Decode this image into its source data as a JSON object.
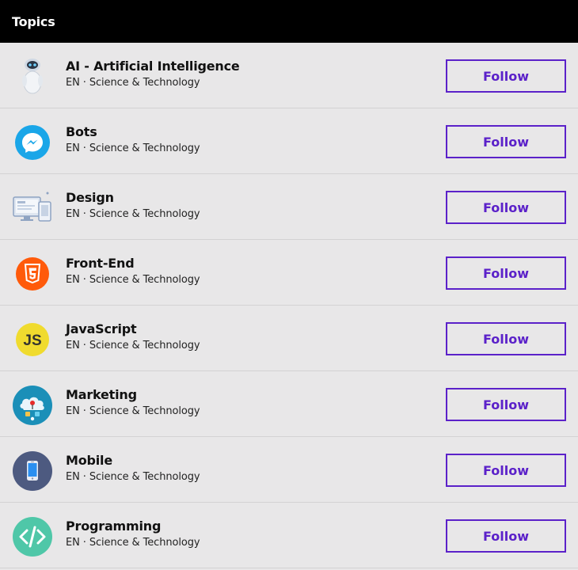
{
  "header": {
    "title": "Topics"
  },
  "topics": [
    {
      "name": "AI - Artificial Intelligence",
      "meta": "EN · Science & Technology",
      "follow_label": "Follow",
      "icon": "robot-icon"
    },
    {
      "name": "Bots",
      "meta": "EN · Science & Technology",
      "follow_label": "Follow",
      "icon": "messenger-icon",
      "color": "#1aa6e8"
    },
    {
      "name": "Design",
      "meta": "EN · Science & Technology",
      "follow_label": "Follow",
      "icon": "devices-icon"
    },
    {
      "name": "Front-End",
      "meta": "EN · Science & Technology",
      "follow_label": "Follow",
      "icon": "html5-icon",
      "color": "#ff5a0a"
    },
    {
      "name": "JavaScript",
      "meta": "EN · Science & Technology",
      "follow_label": "Follow",
      "icon": "js-icon",
      "color": "#f0db2e",
      "icon_text": "JS"
    },
    {
      "name": "Marketing",
      "meta": "EN · Science & Technology",
      "follow_label": "Follow",
      "icon": "cloud-marketing-icon",
      "color": "#1b8fb8"
    },
    {
      "name": "Mobile",
      "meta": "EN · Science & Technology",
      "follow_label": "Follow",
      "icon": "smartphone-icon",
      "color": "#4d5a80"
    },
    {
      "name": "Programming",
      "meta": "EN · Science & Technology",
      "follow_label": "Follow",
      "icon": "code-icon",
      "color": "#4fc7a8"
    }
  ],
  "colors": {
    "accent": "#5b21c9",
    "header_bg": "#000000",
    "page_bg": "#e8e7e8"
  }
}
